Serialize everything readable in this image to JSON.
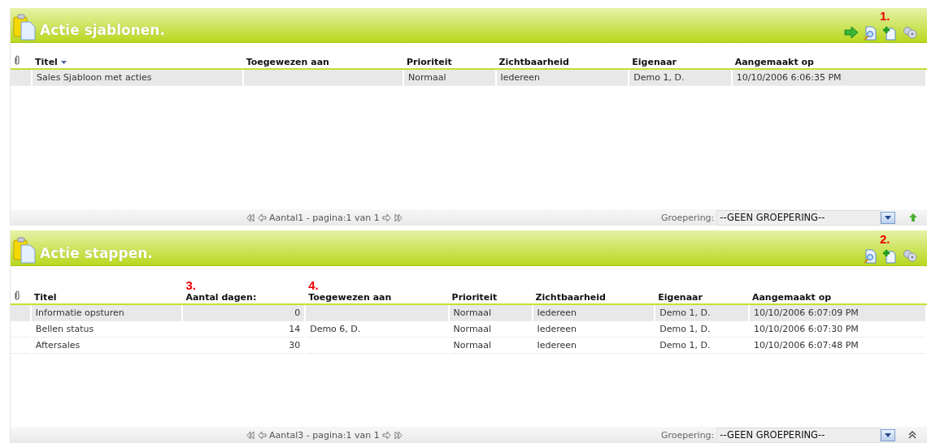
{
  "panels": [
    {
      "title": "Actie sjablonen.",
      "toolbar": [
        {
          "kind": "forward"
        },
        {
          "kind": "preview"
        },
        {
          "kind": "add",
          "annotation": "1."
        },
        {
          "kind": "tools"
        }
      ],
      "columns": [
        {
          "kind": "attachment",
          "sorted": false
        },
        {
          "kind": "text",
          "label": "Titel",
          "sorted": true
        },
        {
          "kind": "text",
          "label": "Toegewezen aan",
          "sorted": false
        },
        {
          "kind": "text",
          "label": "Prioriteit",
          "sorted": false
        },
        {
          "kind": "text",
          "label": "Zichtbaarheid",
          "sorted": false
        },
        {
          "kind": "text",
          "label": "Eigenaar",
          "sorted": false
        },
        {
          "kind": "text",
          "label": "Aangemaakt op",
          "sorted": false
        }
      ],
      "rows": [
        {
          "selected": true,
          "cells": [
            "",
            "Sales Sjabloon met acties",
            "",
            "Normaal",
            "Iedereen",
            "Demo 1, D.",
            "10/10/2006 6:06:35 PM"
          ]
        }
      ],
      "footer": {
        "pager": "Aantal1 - pagina:1 van 1",
        "grouping_label": "Groepering:",
        "grouping_value": "--GEEN GROEPERING--",
        "corner": {
          "kind": "up"
        }
      }
    },
    {
      "title": "Actie stappen.",
      "toolbar": [
        {
          "kind": "preview"
        },
        {
          "kind": "add",
          "annotation": "2."
        },
        {
          "kind": "tools"
        }
      ],
      "columns": [
        {
          "kind": "attachment",
          "sorted": false
        },
        {
          "kind": "text",
          "label": "Titel",
          "sorted": false
        },
        {
          "kind": "number",
          "label": "Aantal dagen:",
          "annotation": "3.",
          "sorted": false
        },
        {
          "kind": "text",
          "label": "Toegewezen aan",
          "annotation": "4.",
          "sorted": false
        },
        {
          "kind": "text",
          "label": "Prioriteit",
          "sorted": false
        },
        {
          "kind": "text",
          "label": "Zichtbaarheid",
          "sorted": false
        },
        {
          "kind": "text",
          "label": "Eigenaar",
          "sorted": false
        },
        {
          "kind": "text",
          "label": "Aangemaakt op",
          "sorted": false
        }
      ],
      "rows": [
        {
          "selected": true,
          "cells": [
            "",
            "Informatie opsturen",
            "0",
            "",
            "Normaal",
            "Iedereen",
            "Demo 1, D.",
            "10/10/2006 6:07:09 PM"
          ]
        },
        {
          "selected": false,
          "cells": [
            "",
            "Bellen status",
            "14",
            "Demo 6, D.",
            "Normaal",
            "Iedereen",
            "Demo 1, D.",
            "10/10/2006 6:07:30 PM"
          ]
        },
        {
          "selected": false,
          "cells": [
            "",
            "Aftersales",
            "30",
            "",
            "Normaal",
            "Iedereen",
            "Demo 1, D.",
            "10/10/2006 6:07:48 PM"
          ]
        }
      ],
      "footer": {
        "pager": "Aantal3 - pagina:1 van 1",
        "grouping_label": "Groepering:",
        "grouping_value": "--GEEN GROEPERING--",
        "corner": {
          "kind": "collapse"
        }
      }
    }
  ]
}
